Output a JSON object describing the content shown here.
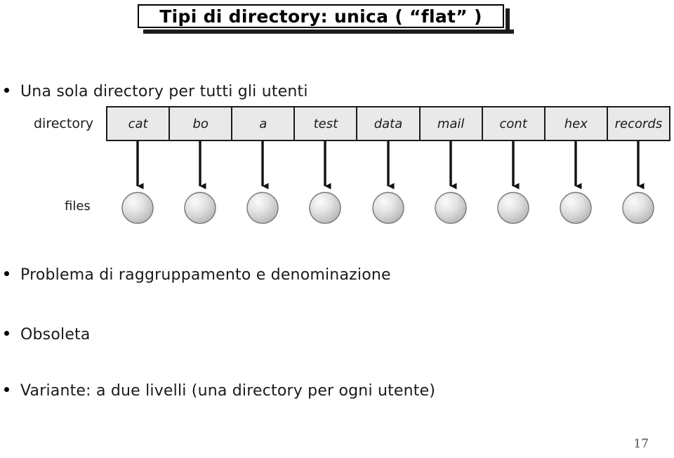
{
  "slide": {
    "title": "Tipi di directory: unica ( “flat” )",
    "page_number": "17"
  },
  "bullets": [
    {
      "text": "Una sola directory per tutti gli utenti"
    },
    {
      "text": "Problema di raggruppamento e denominazione"
    },
    {
      "text": "Obsoleta"
    },
    {
      "text": "Variante: a due livelli (una directory per ogni utente)"
    }
  ],
  "diagram": {
    "directory_label": "directory",
    "files_label": "files",
    "entries": [
      "cat",
      "bo",
      "a",
      "test",
      "data",
      "mail",
      "cont",
      "hex",
      "records"
    ],
    "colors": {
      "cell_fill": "#e9e9e9",
      "cell_border": "#1a1a1a",
      "arrow": "#111111",
      "circle_light": "#f2f2f2",
      "circle_dark": "#b8b8b8",
      "circle_stroke": "#707070"
    }
  }
}
